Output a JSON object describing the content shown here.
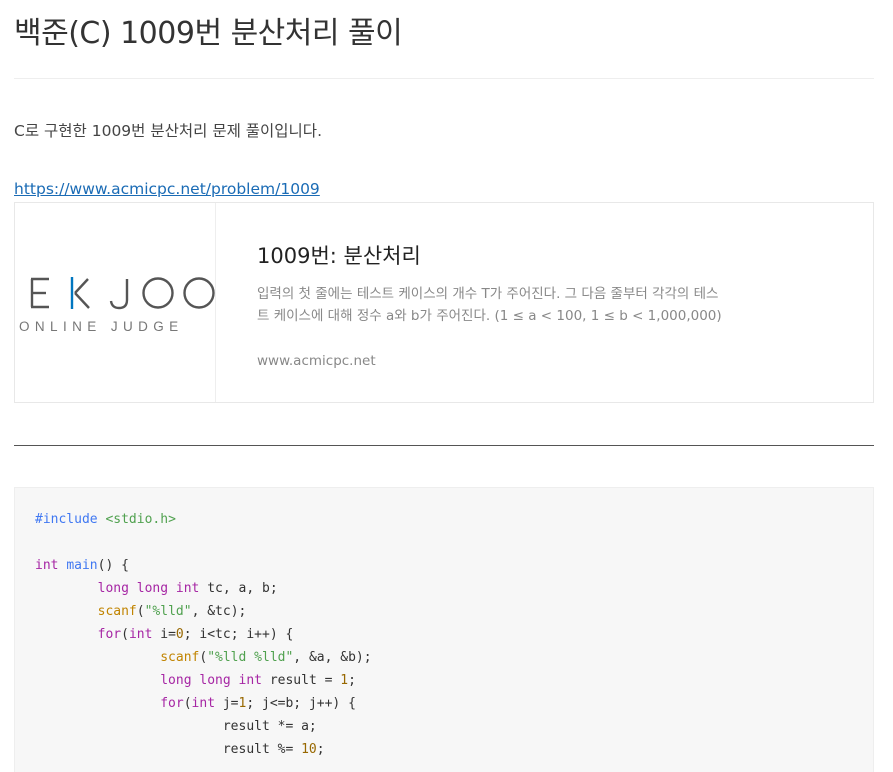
{
  "post": {
    "title": "백준(C) 1009번 분산처리 풀이",
    "intro": "C로 구현한 1009번 분산처리 문제 풀이입니다.",
    "link_text": "https://www.acmicpc.net/problem/1009"
  },
  "og_card": {
    "logo_top": "E  K  J  O  O",
    "logo_bottom": "ONLINE JUDGE",
    "title": "1009번: 분산처리",
    "description": "입력의 첫 줄에는 테스트 케이스의 개수 T가 주어진다. 그 다음 줄부터 각각의 테스트 케이스에 대해 정수 a와 b가 주어진다. (1 ≤ a < 100, 1 ≤ b < 1,000,000)",
    "url": "www.acmicpc.net",
    "accent_color": "#0076c0"
  },
  "code": {
    "lines": [
      "#include <stdio.h>",
      "",
      "int main() {",
      "        long long int tc, a, b;",
      "        scanf(\"%lld\", &tc);",
      "        for(int i=0; i<tc; i++) {",
      "                scanf(\"%lld %lld\", &a, &b);",
      "                long long int result = 1;",
      "                for(int j=1; j<=b; j++) {",
      "                        result *= a;",
      "                        result %= 10;"
    ]
  }
}
